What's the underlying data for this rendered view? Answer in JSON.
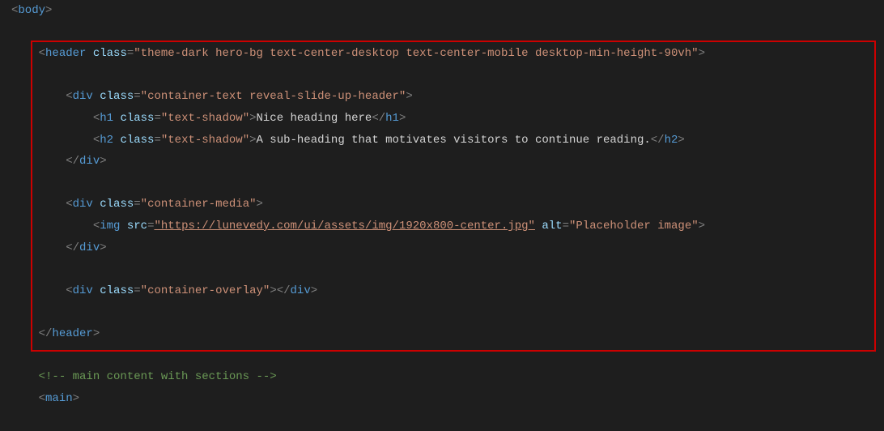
{
  "code": {
    "body_open": "<body>",
    "header_open_1": "<header",
    "header_class_attr": "class",
    "header_class_val": "\"theme-dark hero-bg text-center-desktop text-center-mobile desktop-min-height-90vh\"",
    "header_open_close": ">",
    "div1_open": "<div",
    "div1_class_attr": "class",
    "div1_class_val": "\"container-text reveal-slide-up-header\"",
    "div1_close": ">",
    "h1_open": "<h1",
    "h1_class_attr": "class",
    "h1_class_val": "\"text-shadow\"",
    "h1_bracket": ">",
    "h1_text": "Nice heading here",
    "h1_close": "</h1>",
    "h2_open": "<h2",
    "h2_class_attr": "class",
    "h2_class_val": "\"text-shadow\"",
    "h2_bracket": ">",
    "h2_text": "A sub-heading that motivates visitors to continue reading.",
    "h2_close": "</h2>",
    "div1_end": "</div>",
    "div2_open": "<div",
    "div2_class_attr": "class",
    "div2_class_val": "\"container-media\"",
    "div2_close": ">",
    "img_open": "<img",
    "img_src_attr": "src",
    "img_src_val": "\"https://lunevedy.com/ui/assets/img/1920x800-center.jpg\"",
    "img_alt_attr": "alt",
    "img_alt_val": "\"Placeholder image\"",
    "img_close": ">",
    "div2_end": "</div>",
    "div3_open": "<div",
    "div3_class_attr": "class",
    "div3_class_val": "\"container-overlay\"",
    "div3_close": ">",
    "div3_end": "</div>",
    "header_end": "</header>",
    "comment": "<!-- main content with sections -->",
    "main_open": "<main>"
  }
}
